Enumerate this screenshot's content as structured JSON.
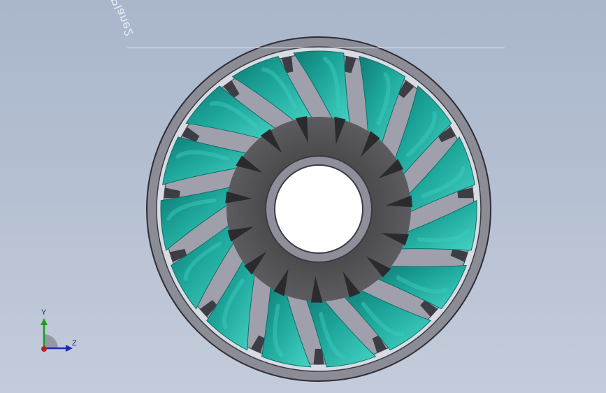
{
  "model": {
    "plane_label": "Plane2",
    "blade_count": 15,
    "colors": {
      "background_top": "#a9b6cb",
      "background_bottom": "#c4ccdb",
      "blade": "#1ea79b",
      "blade_highlight": "#3fcfc0",
      "blade_shadow": "#0d6f68",
      "hub": "#4b4b4d",
      "ring": "#8b8c96",
      "ring_edge": "#3a3b44"
    }
  },
  "triad": {
    "y_label": "Y",
    "z_label": "Z",
    "colors": {
      "y": "#1aa01a",
      "z": "#1b2bb0",
      "x": "#c02020"
    }
  }
}
